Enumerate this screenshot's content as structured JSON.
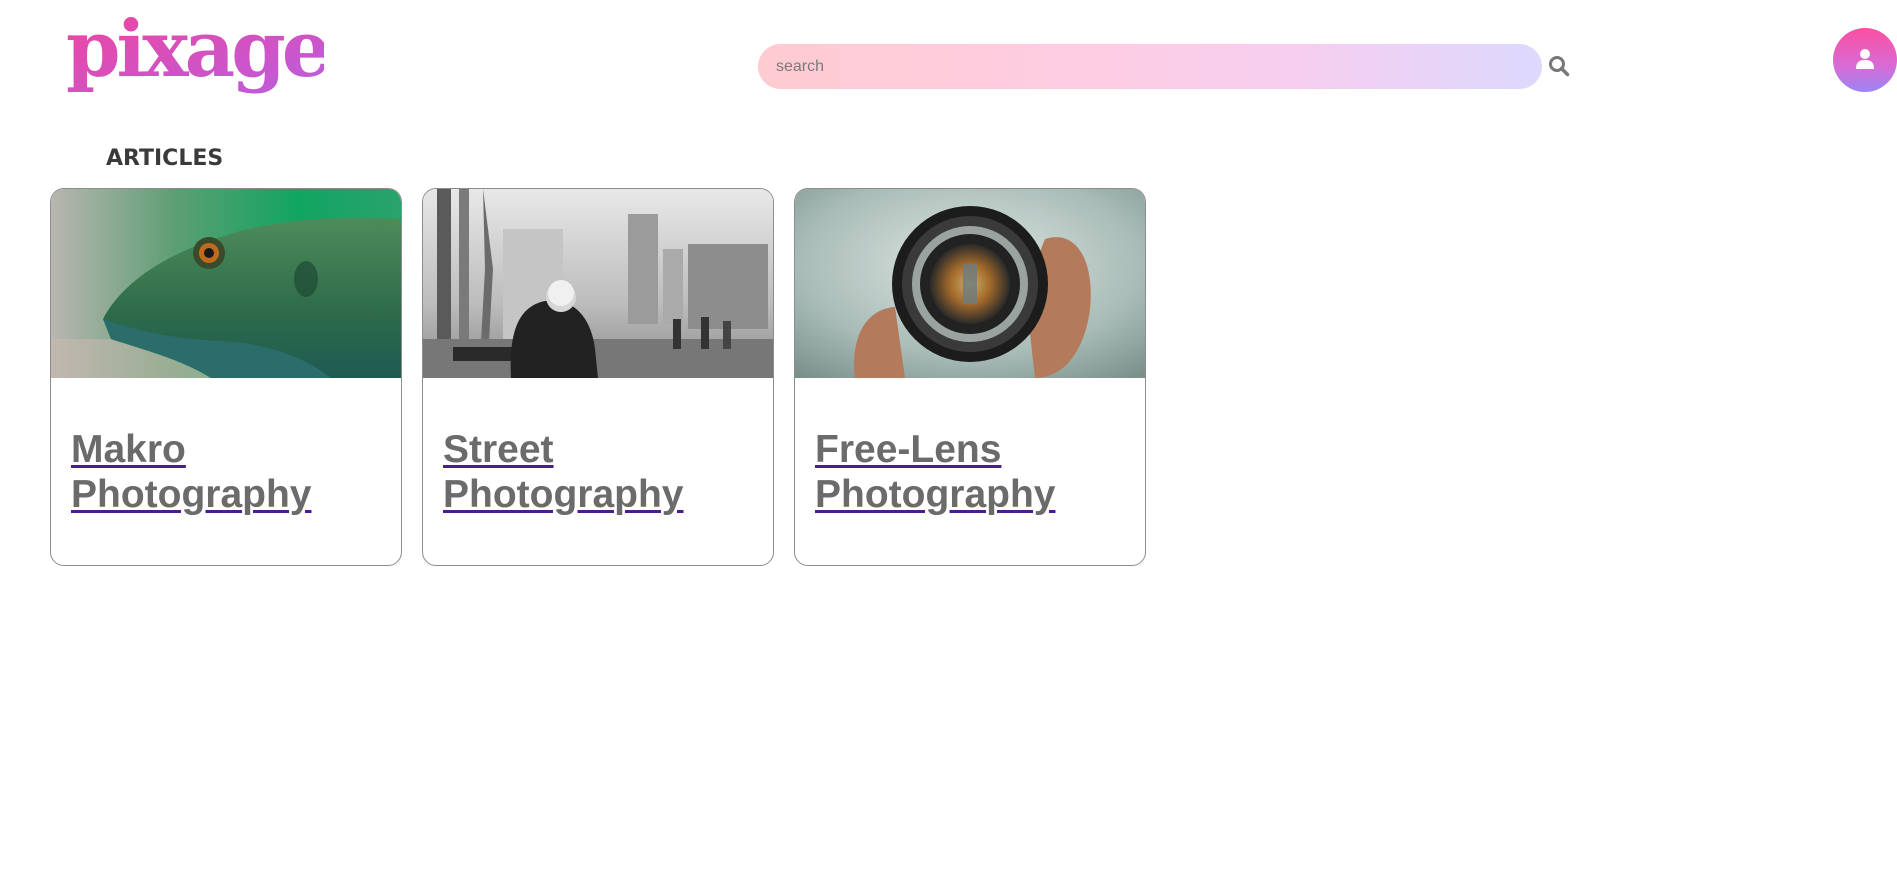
{
  "header": {
    "logo_text": "pixage",
    "search": {
      "placeholder": "search",
      "value": ""
    },
    "icons": {
      "search": "search-icon",
      "user": "user-icon"
    }
  },
  "articles": {
    "heading": "ARTICLES",
    "cards": [
      {
        "title": "Makro Photography",
        "image": "green lizard close-up"
      },
      {
        "title": "Street Photography",
        "image": "black and white street scene with man on bench"
      },
      {
        "title": "Free-Lens Photography",
        "image": "hand holding camera lens showing street"
      }
    ]
  },
  "colors": {
    "brand_pink": "#e4489a",
    "brand_purple": "#b25ee0",
    "link_underline": "#4b1d8c",
    "link_text": "#6b6b6b"
  }
}
